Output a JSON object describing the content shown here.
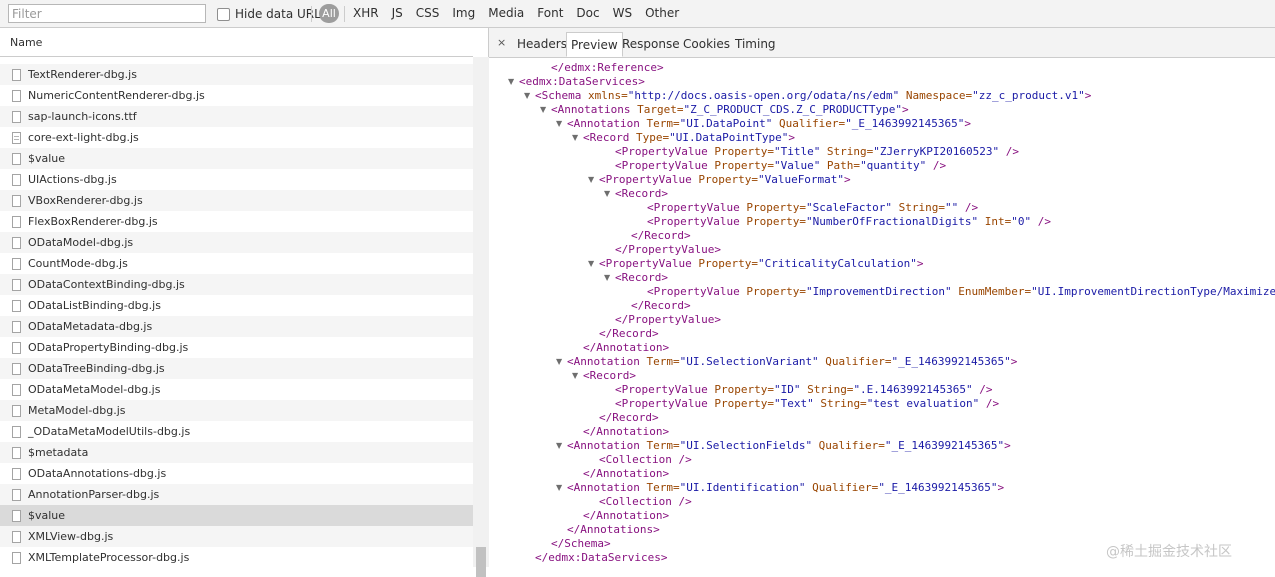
{
  "filter_bar": {
    "placeholder": "Filter",
    "hide_data_urls": "Hide data URLs",
    "all": "All",
    "types": [
      "XHR",
      "JS",
      "CSS",
      "Img",
      "Media",
      "Font",
      "Doc",
      "WS",
      "Other"
    ]
  },
  "request_list": {
    "header": "Name",
    "rows": [
      {
        "name": "",
        "icon": "file-icon"
      },
      {
        "name": "TextRenderer-dbg.js",
        "icon": "file-icon"
      },
      {
        "name": "NumericContentRenderer-dbg.js",
        "icon": "file-icon"
      },
      {
        "name": "sap-launch-icons.ttf",
        "icon": "file-icon"
      },
      {
        "name": "core-ext-light-dbg.js",
        "icon": "document-icon"
      },
      {
        "name": "$value",
        "icon": "file-icon"
      },
      {
        "name": "UIActions-dbg.js",
        "icon": "file-icon"
      },
      {
        "name": "VBoxRenderer-dbg.js",
        "icon": "file-icon"
      },
      {
        "name": "FlexBoxRenderer-dbg.js",
        "icon": "file-icon"
      },
      {
        "name": "ODataModel-dbg.js",
        "icon": "file-icon"
      },
      {
        "name": "CountMode-dbg.js",
        "icon": "file-icon"
      },
      {
        "name": "ODataContextBinding-dbg.js",
        "icon": "file-icon"
      },
      {
        "name": "ODataListBinding-dbg.js",
        "icon": "file-icon"
      },
      {
        "name": "ODataMetadata-dbg.js",
        "icon": "file-icon"
      },
      {
        "name": "ODataPropertyBinding-dbg.js",
        "icon": "file-icon"
      },
      {
        "name": "ODataTreeBinding-dbg.js",
        "icon": "file-icon"
      },
      {
        "name": "ODataMetaModel-dbg.js",
        "icon": "file-icon"
      },
      {
        "name": "MetaModel-dbg.js",
        "icon": "file-icon"
      },
      {
        "name": "_ODataMetaModelUtils-dbg.js",
        "icon": "file-icon"
      },
      {
        "name": "$metadata",
        "icon": "file-icon"
      },
      {
        "name": "ODataAnnotations-dbg.js",
        "icon": "file-icon"
      },
      {
        "name": "AnnotationParser-dbg.js",
        "icon": "file-icon"
      },
      {
        "name": "$value",
        "icon": "file-icon",
        "selected": true
      },
      {
        "name": "XMLView-dbg.js",
        "icon": "file-icon"
      },
      {
        "name": "XMLTemplateProcessor-dbg.js",
        "icon": "file-icon"
      }
    ]
  },
  "detail_tabs": {
    "close": "×",
    "tabs": [
      "Headers",
      "Preview",
      "Response",
      "Cookies",
      "Timing"
    ],
    "active": "Preview"
  },
  "xml_preview": [
    {
      "indent": 2,
      "toggle": "",
      "tokens": [
        [
          "tg",
          "</edmx:Reference>"
        ]
      ]
    },
    {
      "indent": 0,
      "toggle": "▼",
      "tokens": [
        [
          "tg",
          "<edmx:DataServices>"
        ]
      ]
    },
    {
      "indent": 1,
      "toggle": "▼",
      "tokens": [
        [
          "tg",
          "<Schema "
        ],
        [
          "at",
          "xmlns="
        ],
        [
          "av",
          "\"http://docs.oasis-open.org/odata/ns/edm\""
        ],
        [
          "at",
          " Namespace="
        ],
        [
          "av",
          "\"zz_c_product.v1\""
        ],
        [
          "tg",
          ">"
        ]
      ]
    },
    {
      "indent": 2,
      "toggle": "▼",
      "tokens": [
        [
          "tg",
          "<Annotations "
        ],
        [
          "at",
          "Target="
        ],
        [
          "av",
          "\"Z_C_PRODUCT_CDS.Z_C_PRODUCTType\""
        ],
        [
          "tg",
          ">"
        ]
      ]
    },
    {
      "indent": 3,
      "toggle": "▼",
      "tokens": [
        [
          "tg",
          "<Annotation "
        ],
        [
          "at",
          "Term="
        ],
        [
          "av",
          "\"UI.DataPoint\""
        ],
        [
          "at",
          " Qualifier="
        ],
        [
          "av",
          "\"_E_1463992145365\""
        ],
        [
          "tg",
          ">"
        ]
      ]
    },
    {
      "indent": 4,
      "toggle": "▼",
      "tokens": [
        [
          "tg",
          "<Record "
        ],
        [
          "at",
          "Type="
        ],
        [
          "av",
          "\"UI.DataPointType\""
        ],
        [
          "tg",
          ">"
        ]
      ]
    },
    {
      "indent": 6,
      "toggle": "",
      "tokens": [
        [
          "tg",
          "<PropertyValue "
        ],
        [
          "at",
          "Property="
        ],
        [
          "av",
          "\"Title\""
        ],
        [
          "at",
          " String="
        ],
        [
          "av",
          "\"ZJerryKPI20160523\""
        ],
        [
          "tg",
          " />"
        ]
      ]
    },
    {
      "indent": 6,
      "toggle": "",
      "tokens": [
        [
          "tg",
          "<PropertyValue "
        ],
        [
          "at",
          "Property="
        ],
        [
          "av",
          "\"Value\""
        ],
        [
          "at",
          " Path="
        ],
        [
          "av",
          "\"quantity\""
        ],
        [
          "tg",
          " />"
        ]
      ]
    },
    {
      "indent": 5,
      "toggle": "▼",
      "tokens": [
        [
          "tg",
          "<PropertyValue "
        ],
        [
          "at",
          "Property="
        ],
        [
          "av",
          "\"ValueFormat\""
        ],
        [
          "tg",
          ">"
        ]
      ]
    },
    {
      "indent": 6,
      "toggle": "▼",
      "tokens": [
        [
          "tg",
          "<Record>"
        ]
      ]
    },
    {
      "indent": 8,
      "toggle": "",
      "tokens": [
        [
          "tg",
          "<PropertyValue "
        ],
        [
          "at",
          "Property="
        ],
        [
          "av",
          "\"ScaleFactor\""
        ],
        [
          "at",
          " String="
        ],
        [
          "av",
          "\"\""
        ],
        [
          "tg",
          " />"
        ]
      ]
    },
    {
      "indent": 8,
      "toggle": "",
      "tokens": [
        [
          "tg",
          "<PropertyValue "
        ],
        [
          "at",
          "Property="
        ],
        [
          "av",
          "\"NumberOfFractionalDigits\""
        ],
        [
          "at",
          " Int="
        ],
        [
          "av",
          "\"0\""
        ],
        [
          "tg",
          " />"
        ]
      ]
    },
    {
      "indent": 7,
      "toggle": "",
      "tokens": [
        [
          "tg",
          "</Record>"
        ]
      ]
    },
    {
      "indent": 6,
      "toggle": "",
      "tokens": [
        [
          "tg",
          "</PropertyValue>"
        ]
      ]
    },
    {
      "indent": 5,
      "toggle": "▼",
      "tokens": [
        [
          "tg",
          "<PropertyValue "
        ],
        [
          "at",
          "Property="
        ],
        [
          "av",
          "\"CriticalityCalculation\""
        ],
        [
          "tg",
          ">"
        ]
      ]
    },
    {
      "indent": 6,
      "toggle": "▼",
      "tokens": [
        [
          "tg",
          "<Record>"
        ]
      ]
    },
    {
      "indent": 8,
      "toggle": "",
      "tokens": [
        [
          "tg",
          "<PropertyValue "
        ],
        [
          "at",
          "Property="
        ],
        [
          "av",
          "\"ImprovementDirection\""
        ],
        [
          "at",
          " EnumMember="
        ],
        [
          "av",
          "\"UI.ImprovementDirectionType/Maximize\""
        ],
        [
          "tg",
          " />"
        ]
      ]
    },
    {
      "indent": 7,
      "toggle": "",
      "tokens": [
        [
          "tg",
          "</Record>"
        ]
      ]
    },
    {
      "indent": 6,
      "toggle": "",
      "tokens": [
        [
          "tg",
          "</PropertyValue>"
        ]
      ]
    },
    {
      "indent": 5,
      "toggle": "",
      "tokens": [
        [
          "tg",
          "</Record>"
        ]
      ]
    },
    {
      "indent": 4,
      "toggle": "",
      "tokens": [
        [
          "tg",
          "</Annotation>"
        ]
      ]
    },
    {
      "indent": 3,
      "toggle": "▼",
      "tokens": [
        [
          "tg",
          "<Annotation "
        ],
        [
          "at",
          "Term="
        ],
        [
          "av",
          "\"UI.SelectionVariant\""
        ],
        [
          "at",
          " Qualifier="
        ],
        [
          "av",
          "\"_E_1463992145365\""
        ],
        [
          "tg",
          ">"
        ]
      ]
    },
    {
      "indent": 4,
      "toggle": "▼",
      "tokens": [
        [
          "tg",
          "<Record>"
        ]
      ]
    },
    {
      "indent": 6,
      "toggle": "",
      "tokens": [
        [
          "tg",
          "<PropertyValue "
        ],
        [
          "at",
          "Property="
        ],
        [
          "av",
          "\"ID\""
        ],
        [
          "at",
          " String="
        ],
        [
          "av",
          "\".E.1463992145365\""
        ],
        [
          "tg",
          " />"
        ]
      ]
    },
    {
      "indent": 6,
      "toggle": "",
      "tokens": [
        [
          "tg",
          "<PropertyValue "
        ],
        [
          "at",
          "Property="
        ],
        [
          "av",
          "\"Text\""
        ],
        [
          "at",
          " String="
        ],
        [
          "av",
          "\"test evaluation\""
        ],
        [
          "tg",
          " />"
        ]
      ]
    },
    {
      "indent": 5,
      "toggle": "",
      "tokens": [
        [
          "tg",
          "</Record>"
        ]
      ]
    },
    {
      "indent": 4,
      "toggle": "",
      "tokens": [
        [
          "tg",
          "</Annotation>"
        ]
      ]
    },
    {
      "indent": 3,
      "toggle": "▼",
      "tokens": [
        [
          "tg",
          "<Annotation "
        ],
        [
          "at",
          "Term="
        ],
        [
          "av",
          "\"UI.SelectionFields\""
        ],
        [
          "at",
          " Qualifier="
        ],
        [
          "av",
          "\"_E_1463992145365\""
        ],
        [
          "tg",
          ">"
        ]
      ]
    },
    {
      "indent": 5,
      "toggle": "",
      "tokens": [
        [
          "tg",
          "<Collection />"
        ]
      ]
    },
    {
      "indent": 4,
      "toggle": "",
      "tokens": [
        [
          "tg",
          "</Annotation>"
        ]
      ]
    },
    {
      "indent": 3,
      "toggle": "▼",
      "tokens": [
        [
          "tg",
          "<Annotation "
        ],
        [
          "at",
          "Term="
        ],
        [
          "av",
          "\"UI.Identification\""
        ],
        [
          "at",
          " Qualifier="
        ],
        [
          "av",
          "\"_E_1463992145365\""
        ],
        [
          "tg",
          ">"
        ]
      ]
    },
    {
      "indent": 5,
      "toggle": "",
      "tokens": [
        [
          "tg",
          "<Collection />"
        ]
      ]
    },
    {
      "indent": 4,
      "toggle": "",
      "tokens": [
        [
          "tg",
          "</Annotation>"
        ]
      ]
    },
    {
      "indent": 3,
      "toggle": "",
      "tokens": [
        [
          "tg",
          "</Annotations>"
        ]
      ]
    },
    {
      "indent": 2,
      "toggle": "",
      "tokens": [
        [
          "tg",
          "</Schema>"
        ]
      ]
    },
    {
      "indent": 1,
      "toggle": "",
      "tokens": [
        [
          "tg",
          "</edmx:DataServices>"
        ]
      ]
    }
  ],
  "watermark": "@稀土掘金技术社区"
}
